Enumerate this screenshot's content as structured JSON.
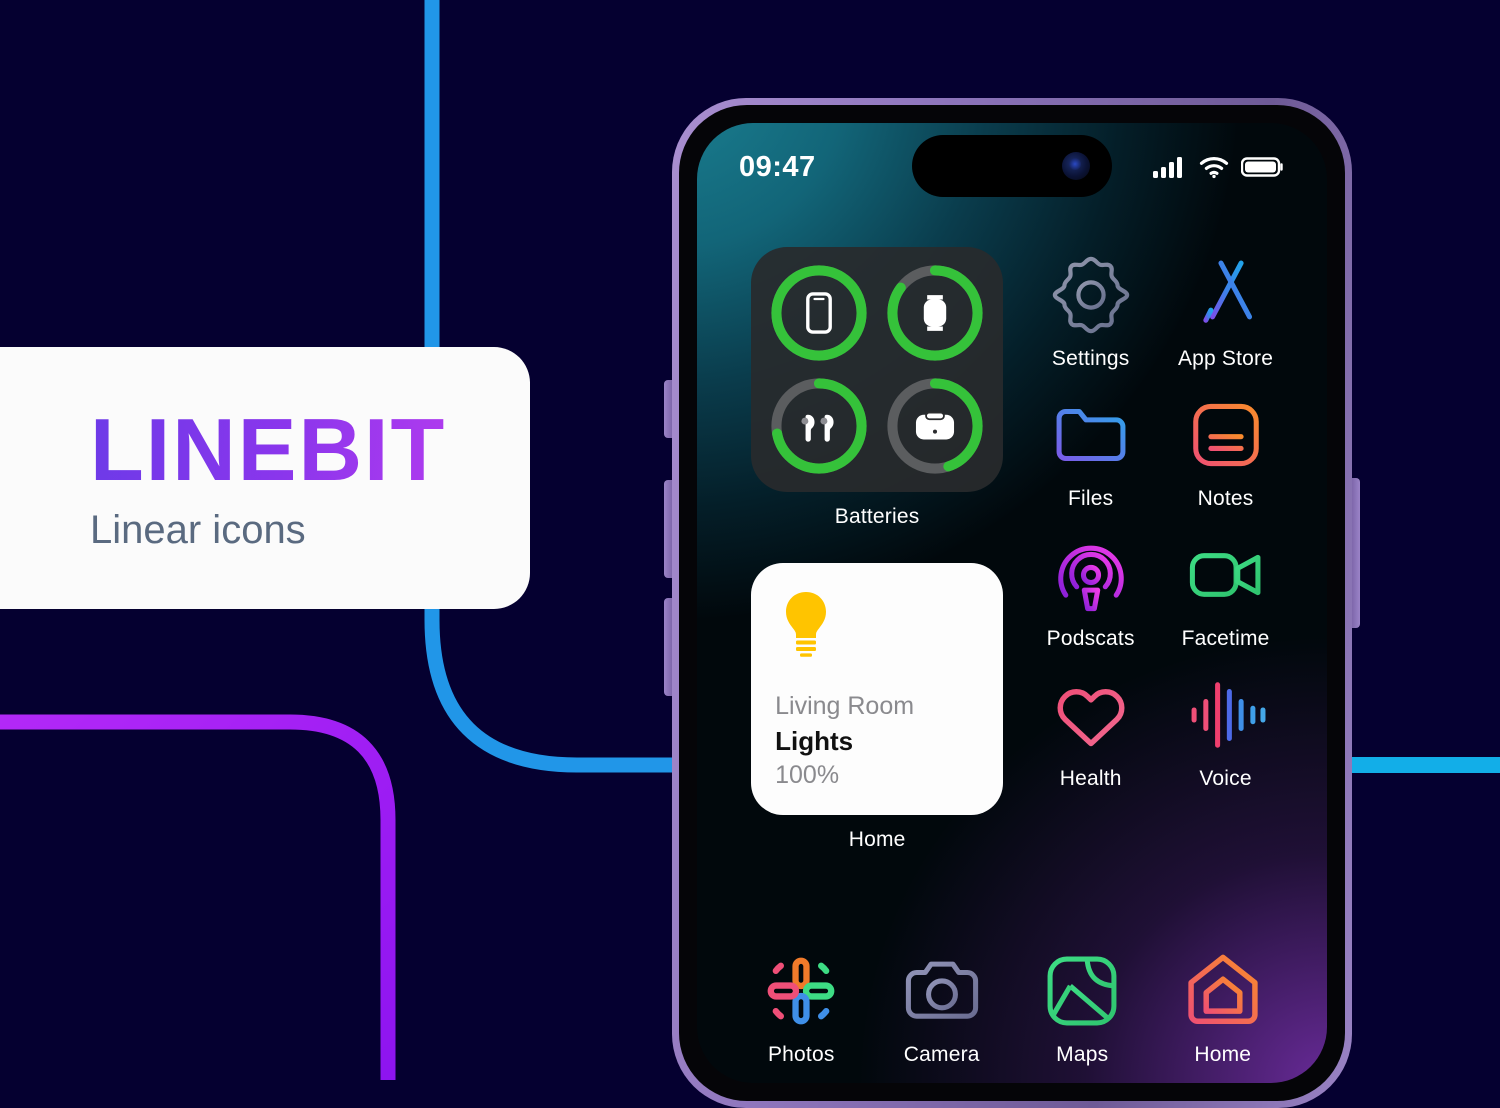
{
  "background": {
    "color": "#050030",
    "lines": [
      {
        "name": "blue-vertical-top",
        "color": "#2196e8"
      },
      {
        "name": "blue-curve-left",
        "color": "#2196e8"
      },
      {
        "name": "blue-horizontal-right",
        "color": "#12aee8"
      },
      {
        "name": "purple-rounded-corner",
        "color": "#a020f5"
      }
    ]
  },
  "brand": {
    "title": "LINEBIT",
    "subtitle": "Linear icons",
    "gradient_from": "#6d3ae8",
    "gradient_to": "#c23df0",
    "subtitle_color": "#5a6a80",
    "card_color": "#fbfbfb"
  },
  "phone": {
    "frame_color": "#9b84c8",
    "buttons": [
      {
        "name": "silence-switch"
      },
      {
        "name": "volume-up-button"
      },
      {
        "name": "volume-down-button"
      },
      {
        "name": "power-button"
      }
    ]
  },
  "status_bar": {
    "time": "09:47",
    "cellular_icon": "signal-bars-icon",
    "cellular_bars": 4,
    "wifi_icon": "wifi-icon",
    "battery_icon": "battery-icon",
    "battery_level": 92,
    "camera_icon": "front-camera-lens-icon"
  },
  "widgets": [
    {
      "name": "batteries",
      "label": "Batteries",
      "type": "battery-rings",
      "track_color": "#5b5d5f",
      "fill_color": "#35c23a",
      "items": [
        {
          "device": "iphone",
          "icon": "iphone-icon",
          "percent": 100
        },
        {
          "device": "apple-watch",
          "icon": "watch-icon",
          "percent": 85
        },
        {
          "device": "airpods",
          "icon": "airpods-icon",
          "percent": 72
        },
        {
          "device": "airpods-case",
          "icon": "airpods-case-icon",
          "percent": 45
        }
      ]
    },
    {
      "name": "home",
      "label": "Home",
      "type": "home-accessory",
      "icon": "lightbulb-icon",
      "icon_color": "#ffc400",
      "room": "Living Room",
      "accessory": "Lights",
      "value": "100%"
    }
  ],
  "apps": {
    "right_column": [
      [
        {
          "label": "Settings",
          "icon": "gear-icon",
          "color_from": "#8d93a8",
          "color_to": "#6d7590"
        },
        {
          "label": "App Store",
          "icon": "app-store-icon",
          "color_from": "#2f9fe8",
          "color_to": "#6f5ce8"
        }
      ],
      [
        {
          "label": "Files",
          "icon": "folder-icon",
          "color_from": "#2f9fe8",
          "color_to": "#7b5ce8"
        },
        {
          "label": "Notes",
          "icon": "notes-icon",
          "color_from": "#f98b2c",
          "color_to": "#ef5f7e"
        }
      ],
      [
        {
          "label": "Podscats",
          "icon": "podcast-icon",
          "color_from": "#e43ce8",
          "color_to": "#8a1fd8"
        },
        {
          "label": "Facetime",
          "icon": "video-camera-icon",
          "color_from": "#3ddc84",
          "color_to": "#2fc46f"
        }
      ],
      [
        {
          "label": "Health",
          "icon": "heart-icon",
          "color_from": "#ef4f78",
          "color_to": "#f06089"
        },
        {
          "label": "Voice",
          "icon": "waveform-icon",
          "color_from": "#ef4f78",
          "color_to": "#3f8fe8"
        }
      ]
    ],
    "bottom_row": [
      {
        "label": "Photos",
        "icon": "photos-pinwheel-icon",
        "color_from": "#f07a2a",
        "color_to": "#3f8fe8"
      },
      {
        "label": "Camera",
        "icon": "camera-icon",
        "color_from": "#8d8fb0",
        "color_to": "#6f7194"
      },
      {
        "label": "Maps",
        "icon": "maps-icon",
        "color_from": "#3ddc84",
        "color_to": "#2fc46f"
      },
      {
        "label": "Home",
        "icon": "house-icon",
        "color_from": "#f98b2c",
        "color_to": "#ef5f7e"
      }
    ]
  }
}
